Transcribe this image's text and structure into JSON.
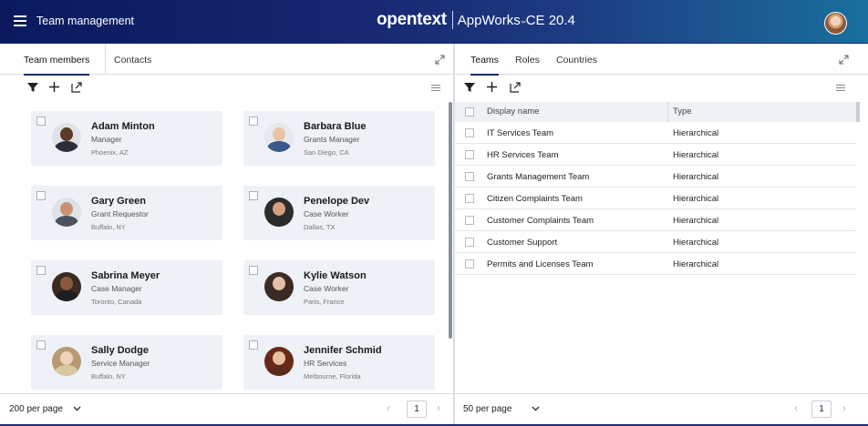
{
  "header": {
    "app_title": "Team management",
    "brand_logo": "opentext",
    "brand_product": "AppWorks",
    "brand_product_suffix": " CE 20.4",
    "menu_icon": "hamburger-icon",
    "avatar_icon": "user-avatar"
  },
  "left_panel": {
    "tabs": [
      {
        "label": "Team members",
        "active": true
      },
      {
        "label": "Contacts",
        "active": false
      }
    ],
    "toolbar_icons": [
      "filter-icon",
      "add-icon",
      "export-icon",
      "list-view-icon"
    ],
    "members": [
      {
        "name": "Adam Minton",
        "role": "Manager",
        "location": "Phoenix, AZ",
        "skin": "#5a3a28",
        "shirt": "#2b2f3a"
      },
      {
        "name": "Barbara Blue",
        "role": "Grants Manager",
        "location": "San Diego, CA",
        "skin": "#e9c2a6",
        "shirt": "#3a5a8c"
      },
      {
        "name": "Gary Green",
        "role": "Grant Requestor",
        "location": "Buffalo, NY",
        "skin": "#c99272",
        "shirt": "#4b5360"
      },
      {
        "name": "Penelope Dev",
        "role": "Case Worker",
        "location": "Dallas, TX",
        "skin": "#d6a080",
        "shirt": "#2a2a2a"
      },
      {
        "name": "Sabrina Meyer",
        "role": "Case Manager",
        "location": "Toronto, Canada",
        "skin": "#8a5a3e",
        "shirt": "#1e1e1e"
      },
      {
        "name": "Kylie Watson",
        "role": "Case Worker",
        "location": "Paris, France",
        "skin": "#e6c0a4",
        "shirt": "#3a2a25"
      },
      {
        "name": "Sally Dodge",
        "role": "Service Manager",
        "location": "Buffalo, NY",
        "skin": "#efd2bc",
        "shirt": "#d9c7a0"
      },
      {
        "name": "Jennifer Schmid",
        "role": "HR Services",
        "location": "Melbourne, Florida",
        "skin": "#e8c0a0",
        "shirt": "#5a2a1a"
      }
    ],
    "footer": {
      "per_page": "200 per page",
      "page": "1"
    }
  },
  "right_panel": {
    "tabs": [
      {
        "label": "Teams",
        "active": true
      },
      {
        "label": "Roles",
        "active": false
      },
      {
        "label": "Countries",
        "active": false
      }
    ],
    "toolbar_icons": [
      "filter-icon",
      "add-icon",
      "export-icon",
      "list-view-icon"
    ],
    "columns": {
      "name": "Display name",
      "type": "Type"
    },
    "rows": [
      {
        "name": "IT Services Team",
        "type": "Hierarchical"
      },
      {
        "name": "HR Services Team",
        "type": "Hierarchical"
      },
      {
        "name": "Grants Management Team",
        "type": "Hierarchical"
      },
      {
        "name": "Citizen Complaints Team",
        "type": "Hierarchical"
      },
      {
        "name": "Customer Complaints Team",
        "type": "Hierarchical"
      },
      {
        "name": "Customer Support",
        "type": "Hierarchical"
      },
      {
        "name": "Permits and Licenses Team",
        "type": "Hierarchical"
      }
    ],
    "footer": {
      "per_page": "50 per page",
      "page": "1"
    }
  }
}
